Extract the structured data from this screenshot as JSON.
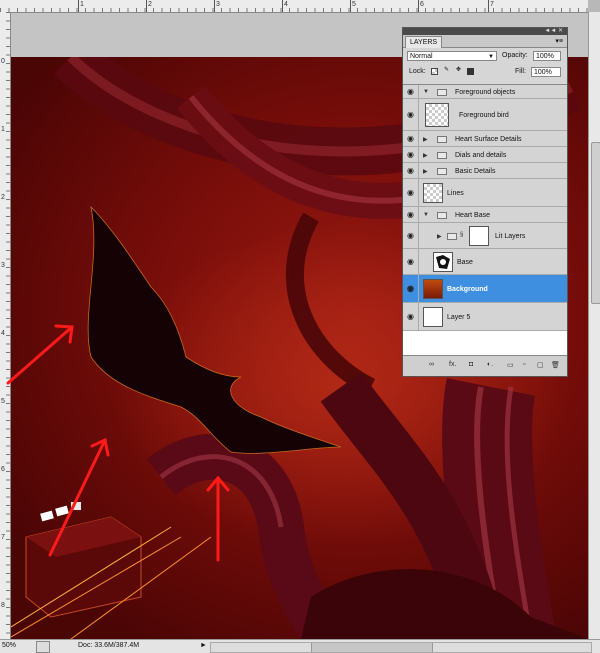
{
  "rulers": {
    "top_numbers": [
      "1",
      "2",
      "3",
      "4",
      "5",
      "6",
      "7"
    ],
    "left_numbers": [
      "0",
      "1",
      "2",
      "3",
      "4",
      "5",
      "6",
      "7",
      "8"
    ]
  },
  "status": {
    "zoom": "50%",
    "doc": "Doc: 33.6M/387.4M",
    "arrow": "►"
  },
  "panel": {
    "tab": "LAYERS",
    "collapse": "◄◄ ✕",
    "menu": "▾≡",
    "blend_mode": "Normal",
    "opacity_label": "Opacity:",
    "opacity_value": "100%",
    "lock_label": "Lock:",
    "fill_label": "Fill:",
    "fill_value": "100%",
    "layers": [
      {
        "name": "Foreground objects",
        "kind": "group"
      },
      {
        "name": "Foreground bird",
        "kind": "layer"
      },
      {
        "name": "Heart Surface Details",
        "kind": "group"
      },
      {
        "name": "Dials and details",
        "kind": "group"
      },
      {
        "name": "Basic Details",
        "kind": "group"
      },
      {
        "name": "Lines",
        "kind": "layer"
      },
      {
        "name": "Heart Base",
        "kind": "group"
      },
      {
        "name": "Lit Layers",
        "kind": "group"
      },
      {
        "name": "Base",
        "kind": "layer"
      },
      {
        "name": "Background",
        "kind": "layer"
      },
      {
        "name": "Layer 5",
        "kind": "layer"
      }
    ],
    "footer": [
      "∞",
      "fx.",
      "◘",
      "◐.",
      "▭",
      "▫",
      "▢",
      "🗑"
    ]
  },
  "accent": {
    "selection": "#3f8fe0",
    "annotation_red": "#ff1a1a",
    "canvas_red": "#8a1410"
  }
}
